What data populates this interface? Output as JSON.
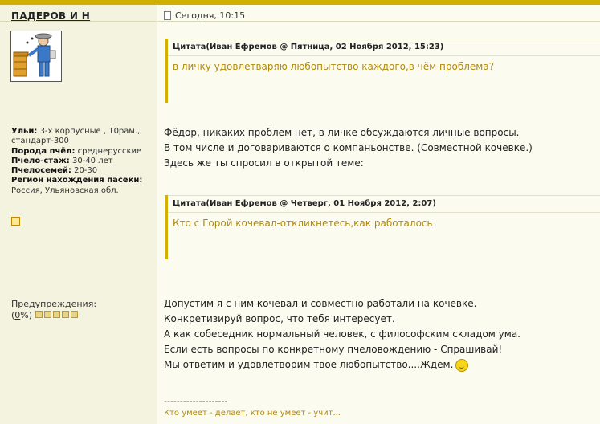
{
  "author": "ПАДЕРОВ И Н",
  "post_date": "Сегодня, 10:15",
  "profile": [
    {
      "label": "Ульи:",
      "value": "3-х корпусные , 10рам., стандарт-300"
    },
    {
      "label": "Порода пчёл:",
      "value": "среднерусские"
    },
    {
      "label": "Пчело-стаж:",
      "value": "30-40 лет"
    },
    {
      "label": "Пчелосемей:",
      "value": "20-30"
    },
    {
      "label": "Регион нахождения пасеки:",
      "value": "Россия, Ульяновская обл."
    }
  ],
  "warnings": {
    "label": "Предупреждения:",
    "open": "(",
    "percent": "0",
    "close": "%)",
    "level": 0
  },
  "quote1": {
    "header": "Цитата(Иван Ефремов @ Пятница, 02 Ноября 2012, 15:23)",
    "body": "в личку удовлетваряю любопытство каждого,в чём проблема?"
  },
  "para1": [
    "Фёдор, никаких проблем нет, в личке обсуждаются личные вопросы.",
    "В том числе и договариваются о компаньонстве. (Совместной кочевке.)",
    "Здесь же ты спросил в открытой теме:"
  ],
  "quote2": {
    "header": "Цитата(Иван Ефремов @ Четверг, 01 Ноября 2012, 2:07)",
    "body": "Кто с Горой кочевал-откликнетесь,как работалось"
  },
  "para2": [
    "Допустим я с ним кочевал и совместно работали на кочевке.",
    "Конкретизируй вопрос, что тебя интересует.",
    "А как собеседник нормальный человек, с философским складом ума.",
    "Если есть вопросы по конкретному пчеловождению - Спрашивай!",
    "Мы ответим и удовлетворим твое любопытство....Ждем."
  ],
  "signature_sep": "--------------------",
  "signature": "Кто умеет - делает, кто не умеет - учит...",
  "icons": {
    "avatar": "beekeeper-avatar",
    "profile": "profile-link-icon",
    "post": "document-icon",
    "smiley": "smiley-icon"
  }
}
